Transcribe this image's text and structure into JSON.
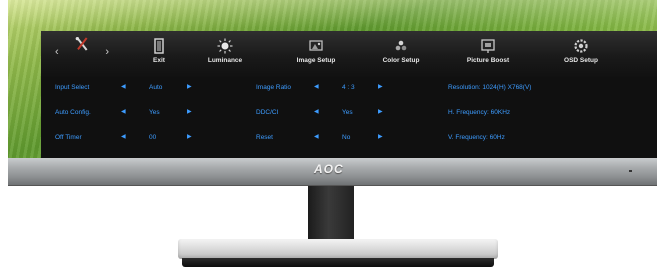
{
  "osd": {
    "tabs": [
      {
        "label": "Exit",
        "icon": "exit-door-icon"
      },
      {
        "label": "Luminance",
        "icon": "sun-icon"
      },
      {
        "label": "Image Setup",
        "icon": "image-setup-icon"
      },
      {
        "label": "Color Setup",
        "icon": "color-setup-icon"
      },
      {
        "label": "Picture Boost",
        "icon": "picture-boost-icon"
      },
      {
        "label": "OSD Setup",
        "icon": "osd-setup-icon"
      }
    ],
    "rows": [
      {
        "label": "Input Select",
        "value": "Auto",
        "label2": "Image Ratio",
        "value2": "4 : 3",
        "info": "Resolution: 1024(H) X768(V)"
      },
      {
        "label": "Auto Config.",
        "value": "Yes",
        "label2": "DDC/CI",
        "value2": "Yes",
        "info": "H. Frequency: 60KHz"
      },
      {
        "label": "Off Timer",
        "value": "00",
        "label2": "Reset",
        "value2": "No",
        "info": "V. Frequency: 60Hz"
      }
    ]
  },
  "bezel": {
    "logo": "AOC"
  },
  "colors": {
    "osd_text": "#3d9cff",
    "osd_bg": "#101010",
    "wallpaper": "#6fa834"
  }
}
